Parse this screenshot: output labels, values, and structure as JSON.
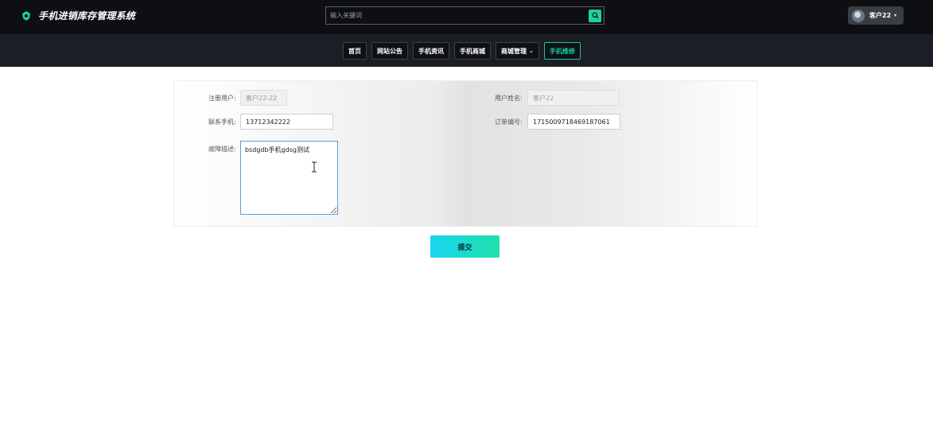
{
  "app": {
    "title": "手机进销库存管理系统"
  },
  "search": {
    "placeholder": "输入关键词"
  },
  "user": {
    "name": "客户22"
  },
  "nav": {
    "items": [
      {
        "label": "首页"
      },
      {
        "label": "网站公告"
      },
      {
        "label": "手机资讯"
      },
      {
        "label": "手机商城"
      },
      {
        "label": "商城管理"
      },
      {
        "label": "手机维修"
      }
    ]
  },
  "form": {
    "registered_user": {
      "label": "注册用户:",
      "value": "客户22-22"
    },
    "user_name": {
      "label": "用户姓名:",
      "value": "客户22"
    },
    "phone": {
      "label": "联系手机:",
      "value": "13712342222"
    },
    "order_no": {
      "label": "订单编号:",
      "value": "1715009718469187061"
    },
    "fault": {
      "label": "故障描述:",
      "value": "bsdgdb手机gdsg测试"
    },
    "submit_label": "提交"
  },
  "colors": {
    "accent": "#19c7a0",
    "topbar": "#0d0f12",
    "navbar": "#1b1e24"
  }
}
